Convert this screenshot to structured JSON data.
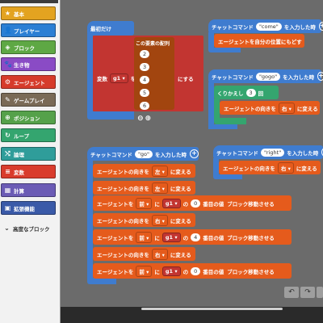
{
  "sidebar": {
    "items": [
      {
        "label": "基本",
        "icon": "★",
        "color": "#e3a320"
      },
      {
        "label": "プレイヤー",
        "icon": "👤",
        "color": "#2b7fd4"
      },
      {
        "label": "ブロック",
        "icon": "◈",
        "color": "#5ea844"
      },
      {
        "label": "生き物",
        "icon": "🐾",
        "color": "#8a4bc5"
      },
      {
        "label": "エージェント",
        "icon": "⚙",
        "color": "#d63b2b"
      },
      {
        "label": "ゲームプレイ",
        "icon": "✎",
        "color": "#7a6a56"
      },
      {
        "label": "ポジション",
        "icon": "⊕",
        "color": "#55a14a"
      },
      {
        "label": "ループ",
        "icon": "↻",
        "color": "#34a56f"
      },
      {
        "label": "論理",
        "icon": "⤭",
        "color": "#2f9d9a"
      },
      {
        "label": "変数",
        "icon": "≡",
        "color": "#d93c2d"
      },
      {
        "label": "計算",
        "icon": "▦",
        "color": "#6b5bb5"
      },
      {
        "label": "拡張機能",
        "icon": "▣",
        "color": "#3a5aa8"
      },
      {
        "label": "高度なブロック",
        "icon": "⌄",
        "color": "#f2f2f2"
      }
    ]
  },
  "start_block": {
    "title": "最初だけ",
    "var_label": "変数",
    "var_name": "g1",
    "to_label": "を",
    "array_label": "この要素の配列",
    "values": [
      "2",
      "3",
      "4",
      "5",
      "6"
    ],
    "set_label": "にする"
  },
  "cmd_come": {
    "prefix": "チャットコマンド",
    "command": "\"come\"",
    "suffix": "を入力した時",
    "action": "エージェントを自分の位置にもどす"
  },
  "cmd_gogo": {
    "prefix": "チャットコマンド",
    "command": "\"gogo\"",
    "suffix": "を入力した時",
    "repeat_label": "くりかえし",
    "repeat_count": "3",
    "repeat_suffix": "回",
    "action_prefix": "エージェントの向きを",
    "direction": "右",
    "action_suffix": "に変える"
  },
  "cmd_go": {
    "prefix": "チャットコマンド",
    "command": "\"go\"",
    "suffix": "を入力した時",
    "rows": [
      {
        "type": "turn",
        "prefix": "エージェントの向きを",
        "dir": "左",
        "suffix": "に変える"
      },
      {
        "type": "turn",
        "prefix": "エージェントの向きを",
        "dir": "左",
        "suffix": "に変える"
      },
      {
        "type": "move",
        "prefix": "エージェントを",
        "dir": "前",
        "to": "に",
        "var": "g1",
        "of": "の",
        "index": "0",
        "suffix": "番目の値",
        "suffix2": "ブロック移動させる"
      },
      {
        "type": "turn",
        "prefix": "エージェントの向きを",
        "dir": "右",
        "suffix": "に変える"
      },
      {
        "type": "move",
        "prefix": "エージェントを",
        "dir": "前",
        "to": "に",
        "var": "g1",
        "of": "の",
        "index": "4",
        "suffix": "番目の値",
        "suffix2": "ブロック移動させる"
      },
      {
        "type": "turn",
        "prefix": "エージェントの向きを",
        "dir": "右",
        "suffix": "に変える"
      },
      {
        "type": "move",
        "prefix": "エージェントを",
        "dir": "前",
        "to": "に",
        "var": "g1",
        "of": "の",
        "index": "0",
        "suffix": "番目の値",
        "suffix2": "ブロック移動させる"
      }
    ]
  },
  "cmd_right": {
    "prefix": "チャットコマンド",
    "command": "\"right\"",
    "suffix": "を入力した時",
    "action_prefix": "エージェントの向きを",
    "direction": "右",
    "action_suffix": "に変える"
  },
  "colors": {
    "workspace": "#6b6b6b",
    "event": "#3f7ccf",
    "agent": "#e55b1c",
    "variable": "#c23531",
    "loop": "#34a56f",
    "math_array": "#a2450f"
  },
  "toolbar": {
    "undo_icon": "undo-icon",
    "redo_icon": "redo-icon"
  }
}
